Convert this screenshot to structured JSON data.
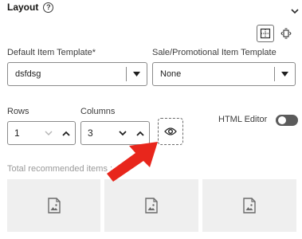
{
  "layout": {
    "title": "Layout",
    "help_icon": "question-circle-icon",
    "collapse_icon": "chevron-down-icon"
  },
  "view_toggles": [
    {
      "name": "grid-view-icon",
      "active": true
    },
    {
      "name": "carousel-view-icon",
      "active": false
    }
  ],
  "default_template": {
    "label": "Default Item Template*",
    "value": "dsfdsg"
  },
  "sale_template": {
    "label": "Sale/Promotional Item Template",
    "value": "None"
  },
  "rows": {
    "label": "Rows",
    "value": "1"
  },
  "columns": {
    "label": "Columns",
    "value": "3"
  },
  "preview_button": {
    "icon": "eye-icon"
  },
  "html_editor": {
    "label": "HTML Editor",
    "enabled": false
  },
  "total_recommended": {
    "label": "Total recommended items :"
  },
  "tiles": [
    {
      "icon": "image-placeholder-icon"
    },
    {
      "icon": "image-placeholder-icon"
    },
    {
      "icon": "image-placeholder-icon"
    }
  ],
  "colors": {
    "annotation_arrow": "#e8261c",
    "tile_bg": "#efefef",
    "toggle_off": "#5b5b5b"
  }
}
